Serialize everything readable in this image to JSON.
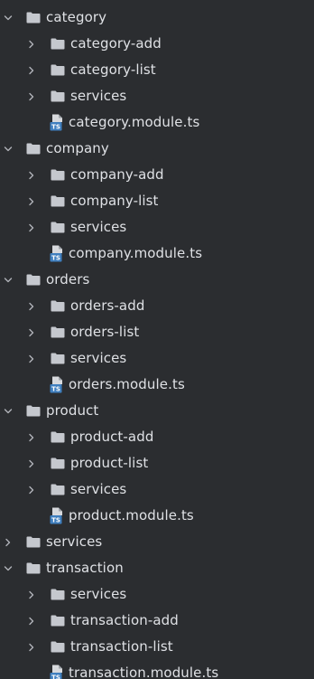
{
  "tree": {
    "folder_color": "#c5c8ce",
    "chevron_color": "#b0b3b8",
    "ts_blue": "#3f7fbf",
    "items": [
      {
        "type": "folder",
        "depth": 0,
        "state": "expanded",
        "label": "category"
      },
      {
        "type": "folder",
        "depth": 1,
        "state": "collapsed",
        "label": "category-add"
      },
      {
        "type": "folder",
        "depth": 1,
        "state": "collapsed",
        "label": "category-list"
      },
      {
        "type": "folder",
        "depth": 1,
        "state": "collapsed",
        "label": "services"
      },
      {
        "type": "file",
        "depth": 1,
        "label": "category.module.ts",
        "icon": "typescript-file-icon",
        "icon_text": "TS"
      },
      {
        "type": "folder",
        "depth": 0,
        "state": "expanded",
        "label": "company"
      },
      {
        "type": "folder",
        "depth": 1,
        "state": "collapsed",
        "label": "company-add"
      },
      {
        "type": "folder",
        "depth": 1,
        "state": "collapsed",
        "label": "company-list"
      },
      {
        "type": "folder",
        "depth": 1,
        "state": "collapsed",
        "label": "services"
      },
      {
        "type": "file",
        "depth": 1,
        "label": "company.module.ts",
        "icon": "typescript-file-icon",
        "icon_text": "TS"
      },
      {
        "type": "folder",
        "depth": 0,
        "state": "expanded",
        "label": "orders"
      },
      {
        "type": "folder",
        "depth": 1,
        "state": "collapsed",
        "label": "orders-add"
      },
      {
        "type": "folder",
        "depth": 1,
        "state": "collapsed",
        "label": "orders-list"
      },
      {
        "type": "folder",
        "depth": 1,
        "state": "collapsed",
        "label": "services"
      },
      {
        "type": "file",
        "depth": 1,
        "label": "orders.module.ts",
        "icon": "typescript-file-icon",
        "icon_text": "TS"
      },
      {
        "type": "folder",
        "depth": 0,
        "state": "expanded",
        "label": "product"
      },
      {
        "type": "folder",
        "depth": 1,
        "state": "collapsed",
        "label": "product-add"
      },
      {
        "type": "folder",
        "depth": 1,
        "state": "collapsed",
        "label": "product-list"
      },
      {
        "type": "folder",
        "depth": 1,
        "state": "collapsed",
        "label": "services"
      },
      {
        "type": "file",
        "depth": 1,
        "label": "product.module.ts",
        "icon": "typescript-file-icon",
        "icon_text": "TS"
      },
      {
        "type": "folder",
        "depth": 0,
        "state": "collapsed",
        "label": "services"
      },
      {
        "type": "folder",
        "depth": 0,
        "state": "expanded",
        "label": "transaction"
      },
      {
        "type": "folder",
        "depth": 1,
        "state": "collapsed",
        "label": "services"
      },
      {
        "type": "folder",
        "depth": 1,
        "state": "collapsed",
        "label": "transaction-add"
      },
      {
        "type": "folder",
        "depth": 1,
        "state": "collapsed",
        "label": "transaction-list"
      },
      {
        "type": "file",
        "depth": 1,
        "label": "transaction.module.ts",
        "icon": "typescript-file-icon",
        "icon_text": "TS"
      }
    ]
  }
}
